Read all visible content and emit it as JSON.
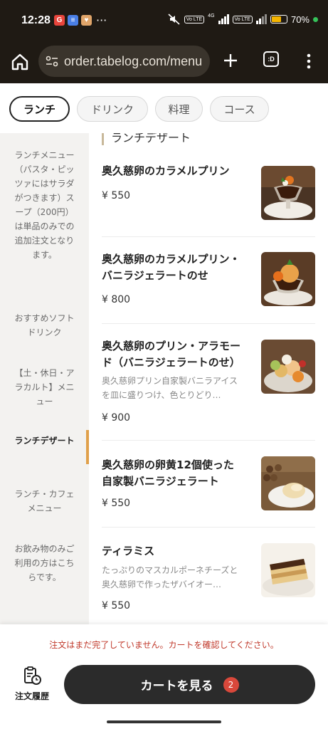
{
  "status_bar": {
    "time": "12:28",
    "apps": [
      {
        "label": "G",
        "color": "#e8453c"
      },
      {
        "label": "≡",
        "color": "#4a7fe6"
      },
      {
        "label": "♥",
        "color": "#e0a56a"
      }
    ],
    "more": "···",
    "lte1": "Vo LTE",
    "net": "4G",
    "lte2": "Vo LTE",
    "battery": "70%",
    "battery_level": 0.7,
    "battery_color": "#f4b400"
  },
  "browser": {
    "url": "order.tabelog.com/menu",
    "tabs_icon_text": ":D"
  },
  "categories": [
    {
      "label": "ランチ",
      "active": true
    },
    {
      "label": "ドリンク",
      "active": false
    },
    {
      "label": "料理",
      "active": false
    },
    {
      "label": "コース",
      "active": false
    }
  ],
  "sidebar": {
    "items": [
      {
        "label": "ランチメニュー（パスタ・ピッツァにはサラダがつきます）スープ（200円）は単品のみでの追加注文となります。",
        "active": false
      },
      {
        "label": "おすすめソフトドリンク",
        "active": false
      },
      {
        "label": "【土・休日・アラカルト】メニュー",
        "active": false
      },
      {
        "label": "ランチデザート",
        "active": true
      },
      {
        "label": "ランチ・カフェメニュー",
        "active": false
      },
      {
        "label": "お飲み物のみご利用の方はこちらです。",
        "active": false
      }
    ],
    "accent_color": "#e0a04a"
  },
  "menu": {
    "section_title": "ランチデザート",
    "items": [
      {
        "name": "奥久慈卵のカラメルプリン",
        "desc": "",
        "price": "¥ 550",
        "photo": "caramel-pudding"
      },
      {
        "name": "奥久慈卵のカラメルプリン・バニラジェラートのせ",
        "desc": "",
        "price": "¥ 800",
        "photo": "pudding-gelato"
      },
      {
        "name": "奥久慈卵のプリン・アラモード（バニラジェラートのせ）",
        "desc": "奥久慈卵プリン自家製バニラアイスを皿に盛りつけ、色とりどり…",
        "price": "¥ 900",
        "photo": "pudding-a-la-mode"
      },
      {
        "name": "奥久慈卵の卵黄12個使った自家製バニラジェラート",
        "desc": "",
        "price": "¥ 550",
        "photo": "vanilla-gelato"
      },
      {
        "name": "ティラミス",
        "desc": "たっぷりのマスカルポーネチーズと奥久慈卵で作ったザバイオー…",
        "price": "¥ 550",
        "photo": "tiramisu"
      }
    ]
  },
  "bottom": {
    "notice": "注文はまだ完了していません。カートを確認してください。",
    "history_label": "注文履歴",
    "cart_label": "カートを見る",
    "cart_count": "2",
    "badge_color": "#d9483b"
  }
}
